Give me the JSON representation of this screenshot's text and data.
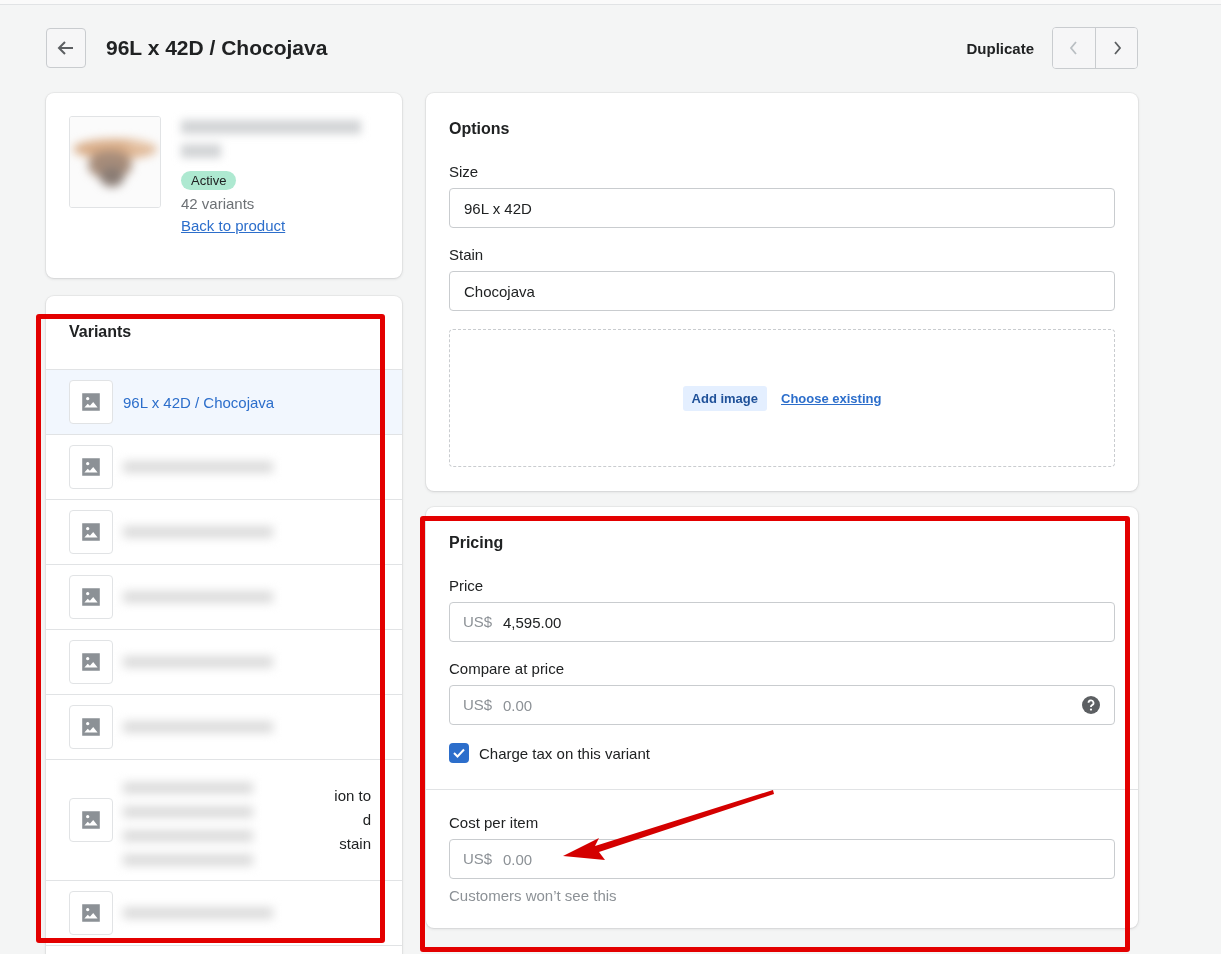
{
  "header": {
    "title": "96L x 42D / Chocojava",
    "duplicate": "Duplicate",
    "prev_disabled": true
  },
  "product": {
    "status": "Active",
    "variant_count": "42 variants",
    "back_link": "Back to product"
  },
  "variants": {
    "title": "Variants",
    "items": [
      {
        "label": "96L x 42D / Chocojava",
        "selected": true
      },
      {
        "selected": false
      },
      {
        "selected": false
      },
      {
        "selected": false
      },
      {
        "selected": false
      },
      {
        "selected": false
      },
      {
        "selected": false,
        "fragments": [
          "ion to",
          "d",
          "stain"
        ]
      },
      {
        "selected": false
      }
    ]
  },
  "options": {
    "title": "Options",
    "fields": [
      {
        "label": "Size",
        "value": "96L x 42D"
      },
      {
        "label": "Stain",
        "value": "Chocojava"
      }
    ],
    "add_image": "Add image",
    "choose_existing": "Choose existing"
  },
  "pricing": {
    "title": "Pricing",
    "fields": [
      {
        "label": "Price",
        "prefix": "US$",
        "value": "4,595.00"
      },
      {
        "label": "Compare at price",
        "prefix": "US$",
        "placeholder": "0.00",
        "help": true
      }
    ],
    "charge_tax": {
      "label": "Charge tax on this variant",
      "checked": true
    },
    "cost": {
      "label": "Cost per item",
      "prefix": "US$",
      "placeholder": "0.00",
      "hint": "Customers won’t see this"
    }
  }
}
